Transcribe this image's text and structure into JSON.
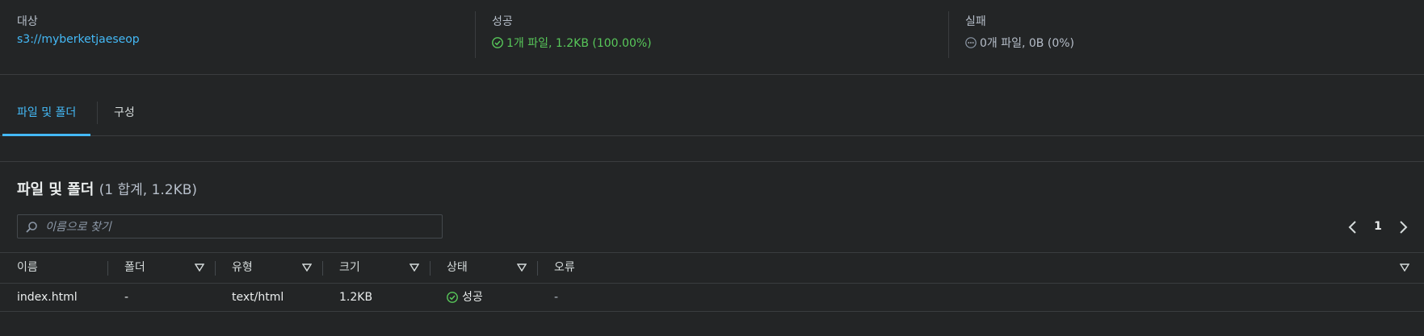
{
  "summary": {
    "destination": {
      "label": "대상",
      "value": "s3://myberketjaeseop"
    },
    "succeeded": {
      "label": "성공",
      "value": "1개 파일, 1.2KB (100.00%)",
      "icon": "check-circle-icon"
    },
    "failed": {
      "label": "실패",
      "value": "0개 파일, 0B (0%)",
      "icon": "dots-circle-icon"
    }
  },
  "tabs": [
    {
      "label": "파일 및 폴더",
      "active": true
    },
    {
      "label": "구성",
      "active": false
    }
  ],
  "files_section": {
    "title": "파일 및 폴더",
    "count": "(1 합계, 1.2KB)",
    "search": {
      "placeholder": "이름으로 찾기",
      "value": ""
    },
    "pagination": {
      "page": "1"
    },
    "columns": [
      "이름",
      "폴더",
      "유형",
      "크기",
      "상태",
      "오류"
    ],
    "rows": [
      {
        "name": "index.html",
        "folder": "-",
        "type": "text/html",
        "size": "1.2KB",
        "status": "성공",
        "error": "-"
      }
    ]
  },
  "colors": {
    "background": "#232526",
    "link": "#44b9f6",
    "success": "#58c85a",
    "border": "#3a3d3f"
  }
}
